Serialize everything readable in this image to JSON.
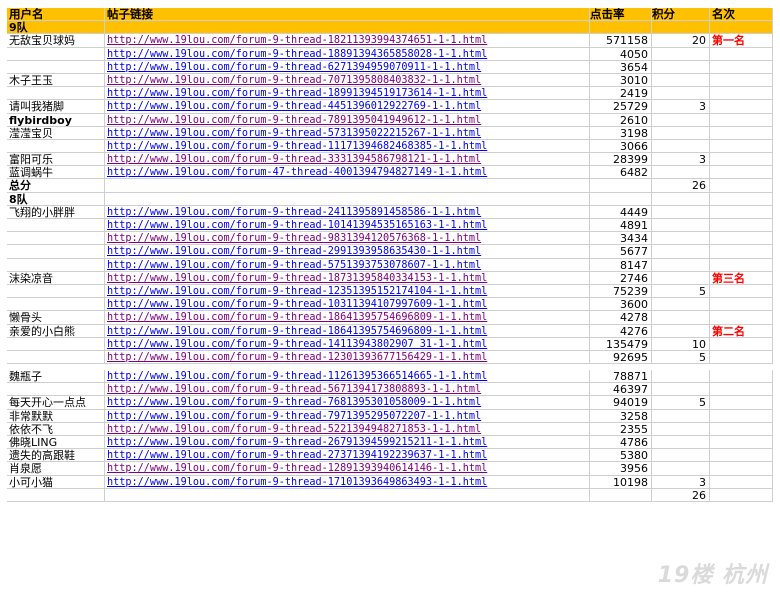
{
  "header": {
    "user": "用户名",
    "link": "帖子链接",
    "clicks": "点击率",
    "score": "积分",
    "rank": "名次"
  },
  "rows": [
    {
      "type": "group",
      "user": "9队",
      "link": "",
      "clicks": "",
      "score": "",
      "rank": ""
    },
    {
      "user": "无敌宝贝球妈",
      "link": "http://www.19lou.com/forum-9-thread-18211393994374651-1-1.html",
      "clicks": "571158",
      "score": "20",
      "rank": "第一名"
    },
    {
      "user": "",
      "link": "http://www.19lou.com/forum-9-thread-18891394365858028-1-1.html",
      "clicks": "4050",
      "score": "",
      "rank": ""
    },
    {
      "user": "",
      "link": "http://www.19lou.com/forum-9-thread-6271394959070911-1-1.html",
      "clicks": "3654",
      "score": "",
      "rank": ""
    },
    {
      "user": "木子王玉",
      "link": "http://www.19lou.com/forum-9-thread-7071395808403832-1-1.html",
      "clicks": "3010",
      "score": "",
      "rank": ""
    },
    {
      "user": "",
      "link": "http://www.19lou.com/forum-9-thread-18991394519173614-1-1.html",
      "clicks": "2419",
      "score": "",
      "rank": ""
    },
    {
      "user": "请叫我猪脚",
      "link": "http://www.19lou.com/forum-9-thread-4451396012922769-1-1.html",
      "clicks": "25729",
      "score": "3",
      "rank": ""
    },
    {
      "type": "bold",
      "user": "flybirdboy",
      "link": "http://www.19lou.com/forum-9-thread-7891395041949612-1-1.html",
      "clicks": "2610",
      "score": "",
      "rank": ""
    },
    {
      "user": "滢滢宝贝",
      "link": "http://www.19lou.com/forum-9-thread-5731395022215267-1-1.html",
      "clicks": "3198",
      "score": "",
      "rank": ""
    },
    {
      "user": "",
      "link": "http://www.19lou.com/forum-9-thread-11171394682468385-1-1.html",
      "clicks": "3066",
      "score": "",
      "rank": ""
    },
    {
      "user": "富阳可乐",
      "link": "http://www.19lou.com/forum-9-thread-3331394586798121-1-1.html",
      "clicks": "28399",
      "score": "3",
      "rank": ""
    },
    {
      "user": "蓝调蜗牛",
      "link": "http://www.19lou.com/forum-47-thread-4001394794827149-1-1.html",
      "clicks": "6482",
      "score": "",
      "rank": ""
    },
    {
      "type": "bold",
      "user": "总分",
      "link": "",
      "clicks": "",
      "score": "26",
      "rank": ""
    },
    {
      "type": "bold",
      "user": "8队",
      "link": "",
      "clicks": "",
      "score": "",
      "rank": ""
    },
    {
      "user": "飞翔的小胖胖",
      "link": "http://www.19lou.com/forum-9-thread-2411395891458586-1-1.html",
      "clicks": "4449",
      "score": "",
      "rank": ""
    },
    {
      "user": "",
      "link": "http://www.19lou.com/forum-9-thread-10141394535165163-1-1.html",
      "clicks": "4891",
      "score": "",
      "rank": ""
    },
    {
      "user": "",
      "link": "http://www.19lou.com/forum-9-thread-9831394120576368-1-1.html",
      "clicks": "3434",
      "score": "",
      "rank": ""
    },
    {
      "user": "",
      "link": "http://www.19lou.com/forum-9-thread-2991393958635430-1-1.html",
      "clicks": "5677",
      "score": "",
      "rank": ""
    },
    {
      "user": "",
      "link": "http://www.19lou.com/forum-9-thread-5751393753078607-1-1.html",
      "clicks": "8147",
      "score": "",
      "rank": ""
    },
    {
      "user": "沫染凉音",
      "link": "http://www.19lou.com/forum-9-thread-18731395840334153-1-1.html",
      "clicks": "2746",
      "score": "",
      "rank": "第三名"
    },
    {
      "user": "",
      "link": "http://www.19lou.com/forum-9-thread-12351395152174104-1-1.html",
      "clicks": "75239",
      "score": "5",
      "rank": ""
    },
    {
      "user": "",
      "link": "http://www.19lou.com/forum-9-thread-10311394107997609-1-1.html",
      "clicks": "3600",
      "score": "",
      "rank": ""
    },
    {
      "user": "懒骨头",
      "link": "http://www.19lou.com/forum-9-thread-18641395754696809-1-1.html",
      "clicks": "4278",
      "score": "",
      "rank": ""
    },
    {
      "user": "亲爱的小白熊",
      "link": "http://www.19lou.com/forum-9-thread-18641395754696809-1-1.html",
      "clicks": "4276",
      "score": "",
      "rank": "第二名"
    },
    {
      "user": "",
      "link": "http://www.19lou.com/forum-9-thread-14113943802907 31-1-1.html",
      "clicks": "135479",
      "score": "10",
      "rank": ""
    },
    {
      "user": "",
      "link": "http://www.19lou.com/forum-9-thread-12301393677156429-1-1.html",
      "clicks": "92695",
      "score": "5",
      "rank": ""
    }
  ],
  "rows2": [
    {
      "user": "魏瓶子",
      "link": "http://www.19lou.com/forum-9-thread-11261395366514665-1-1.html",
      "clicks": "78871",
      "score": "",
      "rank": ""
    },
    {
      "user": "",
      "link": "http://www.19lou.com/forum-9-thread-5671394173808893-1-1.html",
      "clicks": "46397",
      "score": "",
      "rank": ""
    },
    {
      "user": "每天开心一点点",
      "link": "http://www.19lou.com/forum-9-thread-7681395301058009-1-1.html",
      "clicks": "94019",
      "score": "5",
      "rank": ""
    },
    {
      "user": "非常默默",
      "link": "http://www.19lou.com/forum-9-thread-7971395295072207-1-1.html",
      "clicks": "3258",
      "score": "",
      "rank": ""
    },
    {
      "user": "依依不飞",
      "link": "http://www.19lou.com/forum-9-thread-5221394948271853-1-1.html",
      "clicks": "2355",
      "score": "",
      "rank": ""
    },
    {
      "user": "佛晓LING",
      "link": "http://www.19lou.com/forum-9-thread-26791394599215211-1-1.html",
      "clicks": "4786",
      "score": "",
      "rank": ""
    },
    {
      "user": "遗失的高跟鞋",
      "link": "http://www.19lou.com/forum-9-thread-27371394192239637-1-1.html",
      "clicks": "5380",
      "score": "",
      "rank": ""
    },
    {
      "user": "肖泉愿",
      "link": "http://www.19lou.com/forum-9-thread-12891393940614146-1-1.html",
      "clicks": "3956",
      "score": "",
      "rank": ""
    },
    {
      "user": "小可小猫",
      "link": "http://www.19lou.com/forum-9-thread-17101393649863493-1-1.html",
      "clicks": "10198",
      "score": "3",
      "rank": ""
    },
    {
      "user": "",
      "link": "",
      "clicks": "",
      "score": "26",
      "rank": ""
    }
  ],
  "watermark": "19楼 杭州"
}
